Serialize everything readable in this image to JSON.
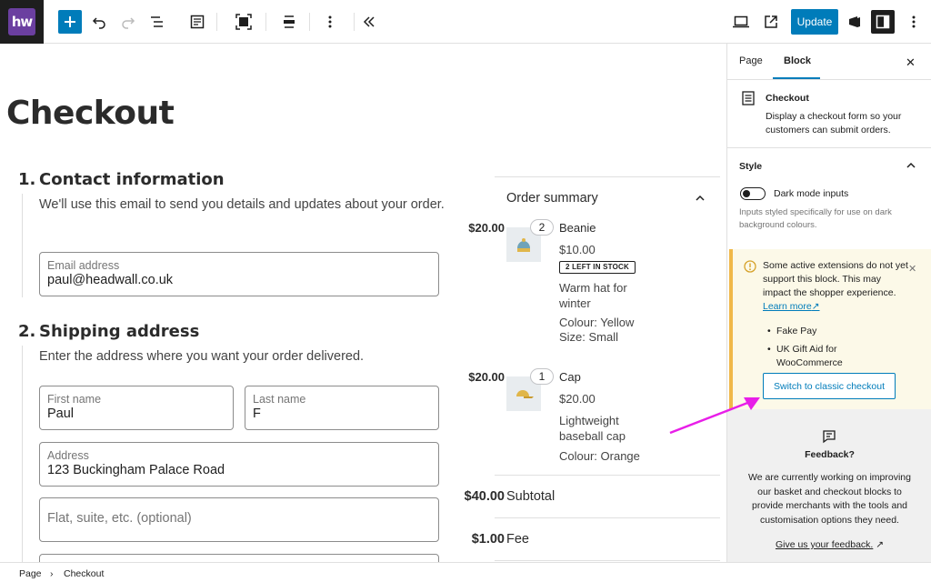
{
  "colors": {
    "accent": "#007cba",
    "logo_bg": "#6b3fa0",
    "notice_bg": "#fcf9e8",
    "notice_border": "#f0b849",
    "annotation_arrow": "#e81ee8"
  },
  "toolbar": {
    "logo_text": "hw",
    "icons": [
      "plus-icon",
      "undo-icon",
      "redo-icon",
      "list-view-icon",
      "document-overview-icon",
      "select-icon",
      "align-icon",
      "more-options-icon",
      "collapse-icon",
      "desktop-preview-icon",
      "external-view-icon",
      "styles-icon",
      "settings-icon",
      "options-icon"
    ],
    "update_label": "Update"
  },
  "page": {
    "title": "Checkout"
  },
  "contact": {
    "number": "1.",
    "title": "Contact information",
    "description": "We'll use this email to send you details and updates about your order.",
    "email_label": "Email address",
    "email_value": "paul@headwall.co.uk"
  },
  "shipping": {
    "number": "2.",
    "title": "Shipping address",
    "description": "Enter the address where you want your order delivered.",
    "first_name_label": "First name",
    "first_name_value": "Paul",
    "last_name_label": "Last name",
    "last_name_value": "F",
    "address_label": "Address",
    "address_value": "123 Buckingham Palace Road",
    "address2_placeholder": "Flat, suite, etc. (optional)"
  },
  "summary": {
    "title": "Order summary",
    "items": [
      {
        "qty": "2",
        "name": "Beanie",
        "price": "$20.00",
        "unit_price": "$10.00",
        "badge": "2 LEFT IN STOCK",
        "description": "Warm hat for winter",
        "attr1": "Colour: Yellow",
        "attr2": "Size: Small",
        "icon": "beanie-icon"
      },
      {
        "qty": "1",
        "name": "Cap",
        "price": "$20.00",
        "unit_price": "$20.00",
        "description": "Lightweight baseball cap",
        "attr1": "Colour: Orange",
        "icon": "cap-icon"
      }
    ],
    "subtotal_label": "Subtotal",
    "subtotal_value": "$40.00",
    "fee_label": "Fee",
    "fee_value": "$1.00"
  },
  "sidebar": {
    "tab_page": "Page",
    "tab_block": "Block",
    "close": "✕",
    "block_title": "Checkout",
    "block_description": "Display a checkout form so your customers can submit orders.",
    "style_title": "Style",
    "dark_mode_label": "Dark mode inputs",
    "dark_mode_help": "Inputs styled specifically for use on dark background colours.",
    "notice_text": "Some active extensions do not yet support this block. This may impact the shopper experience.",
    "notice_link": "Learn more",
    "notice_link_icon": "↗",
    "notice_extensions": [
      "Fake Pay",
      "UK Gift Aid for WooCommerce"
    ],
    "notice_button": "Switch to classic checkout",
    "feedback_title": "Feedback?",
    "feedback_text": "We are currently working on improving our basket and checkout blocks to provide merchants with the tools and customisation options they need.",
    "feedback_link": "Give us your feedback.",
    "feedback_link_icon": "↗"
  },
  "footer": {
    "crumb1": "Page",
    "separator": "›",
    "crumb2": "Checkout"
  }
}
